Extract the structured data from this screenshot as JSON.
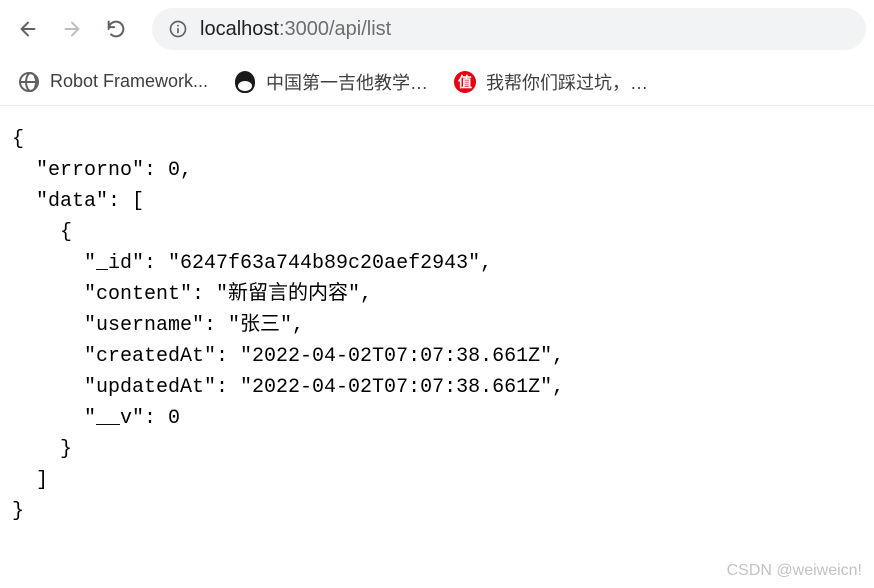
{
  "toolbar": {
    "url_host": "localhost",
    "url_path": ":3000/api/list"
  },
  "bookmarks": [
    {
      "label": "Robot Framework...",
      "iconType": "globe"
    },
    {
      "label": "中国第一吉他教学…",
      "iconType": "penguin"
    },
    {
      "label": "我帮你们踩过坑，…",
      "iconType": "zhi",
      "iconText": "值"
    }
  ],
  "response": {
    "errorno": 0,
    "data": [
      {
        "_id": "6247f63a744b89c20aef2943",
        "content": "新留言的内容",
        "username": "张三",
        "createdAt": "2022-04-02T07:07:38.661Z",
        "updatedAt": "2022-04-02T07:07:38.661Z",
        "__v": 0
      }
    ]
  },
  "json_lines": [
    "{",
    "  \"errorno\": 0,",
    "  \"data\": [",
    "    {",
    "      \"_id\": \"6247f63a744b89c20aef2943\",",
    "      \"content\": \"新留言的内容\",",
    "      \"username\": \"张三\",",
    "      \"createdAt\": \"2022-04-02T07:07:38.661Z\",",
    "      \"updatedAt\": \"2022-04-02T07:07:38.661Z\",",
    "      \"__v\": 0",
    "    }",
    "  ]",
    "}"
  ],
  "watermark": "CSDN @weiweicn!"
}
